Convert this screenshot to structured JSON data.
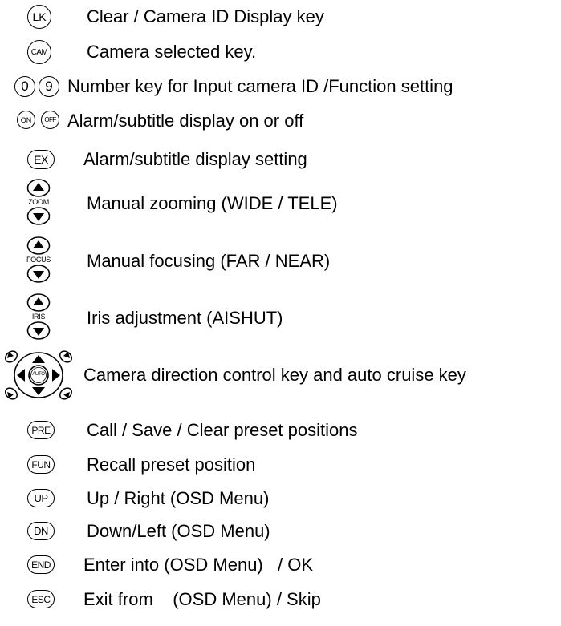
{
  "rows": [
    {
      "icon": "lk-key-icon",
      "key_label": "LK",
      "text": "Clear / Camera ID Display key"
    },
    {
      "icon": "cam-key-icon",
      "key_label": "CAM",
      "text": "Camera selected key."
    },
    {
      "icon": "number-keys-icon",
      "key_labels": [
        "0",
        "9"
      ],
      "text": "Number key for Input camera ID /Function setting"
    },
    {
      "icon": "on-off-keys-icon",
      "key_labels": [
        "ON",
        "OFF"
      ],
      "text": "Alarm/subtitle display on or off"
    },
    {
      "icon": "ex-key-icon",
      "key_label": "EX",
      "text": "Alarm/subtitle display setting"
    },
    {
      "icon": "zoom-keys-icon",
      "key_label": "ZOOM",
      "text": "Manual zooming (WIDE / TELE)"
    },
    {
      "icon": "focus-keys-icon",
      "key_label": "FOCUS",
      "text": "Manual focusing (FAR / NEAR)"
    },
    {
      "icon": "iris-keys-icon",
      "key_label": "IRIS",
      "text": "Iris adjustment (AISHUT)"
    },
    {
      "icon": "direction-pad-icon",
      "key_label": "AUTO",
      "text": "Camera direction control key and auto cruise key"
    },
    {
      "icon": "pre-key-icon",
      "key_label": "PRE",
      "text": "Call / Save / Clear preset positions"
    },
    {
      "icon": "fun-key-icon",
      "key_label": "FUN",
      "text": "Recall preset position"
    },
    {
      "icon": "up-key-icon",
      "key_label": "UP",
      "text": "Up / Right (OSD Menu)"
    },
    {
      "icon": "dn-key-icon",
      "key_label": "DN",
      "text": "Down/Left (OSD Menu)"
    },
    {
      "icon": "end-key-icon",
      "key_label": "END",
      "text": "Enter into (OSD Menu)   / OK"
    },
    {
      "icon": "esc-key-icon",
      "key_label": "ESC",
      "text": "Exit from    (OSD Menu) / Skip"
    }
  ]
}
